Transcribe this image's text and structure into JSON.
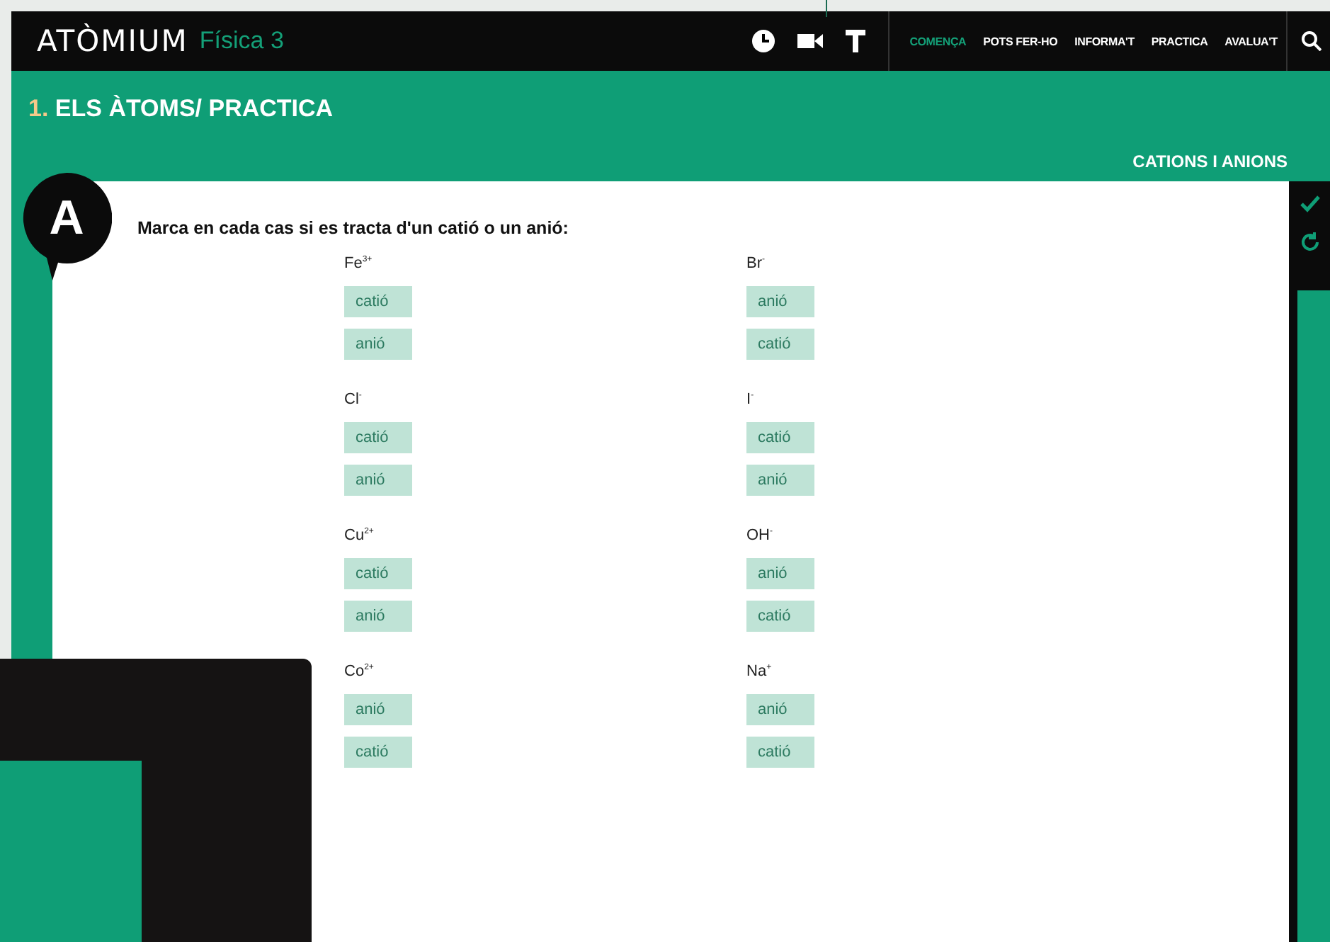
{
  "header": {
    "logo": "ATÒMIUM",
    "subtitle": "Física 3",
    "nav": [
      {
        "label": "COMENÇA",
        "selected": true
      },
      {
        "label": "POTS FER-HO",
        "selected": false
      },
      {
        "label": "INFORMA'T",
        "selected": false
      },
      {
        "label": "PRACTICA",
        "selected": false
      },
      {
        "label": "AVALUA'T",
        "selected": false
      }
    ]
  },
  "page_title": {
    "number": "1.",
    "text": "ELS ÀTOMS/ PRACTICA"
  },
  "section_label": "CATIONS I ANIONS",
  "activity": {
    "letter": "A",
    "instruction": "Marca en cada cas si es tracta d'un catió o un anió:",
    "items": [
      {
        "ion": "Fe$^{3+}$",
        "options": [
          "catió",
          "anió"
        ]
      },
      {
        "ion": "Br$^{-}$",
        "options": [
          "anió",
          "catió"
        ]
      },
      {
        "ion": "Cl$^{-}$",
        "options": [
          "catió",
          "anió"
        ]
      },
      {
        "ion": "I$^{-}$",
        "options": [
          "catió",
          "anió"
        ]
      },
      {
        "ion": "Cu$^{2+}$",
        "options": [
          "catió",
          "anió"
        ]
      },
      {
        "ion": "OH$^{-}$",
        "options": [
          "anió",
          "catió"
        ]
      },
      {
        "ion": "Co$^{2+}$",
        "options": [
          "anió",
          "catió"
        ]
      },
      {
        "ion": "Na$^{+}$",
        "options": [
          "anió",
          "catió"
        ]
      }
    ]
  }
}
